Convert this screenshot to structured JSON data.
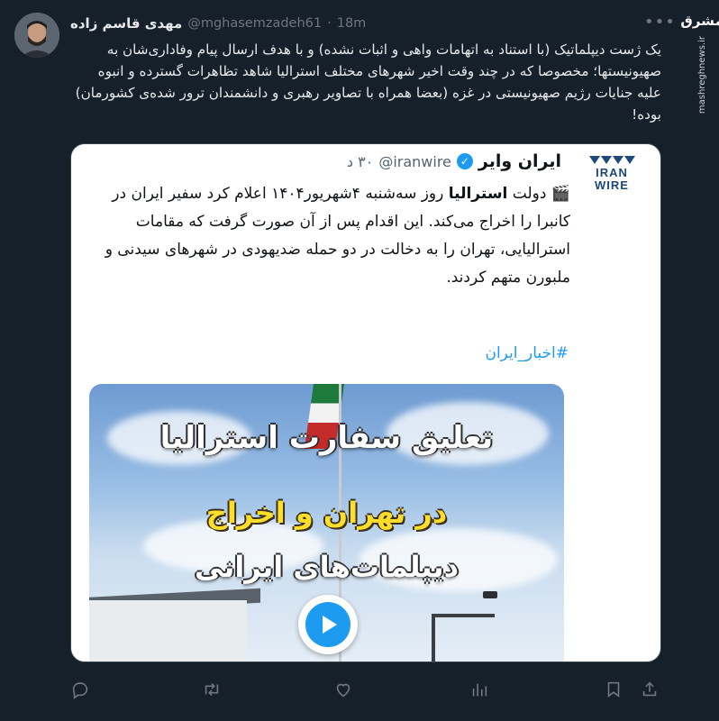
{
  "watermark": {
    "logo": "مشرق",
    "url": "mashreghnews.ir"
  },
  "tweet": {
    "author_name": "مهدی قاسم زاده",
    "handle": "@mghasemzadeh61",
    "separator": "·",
    "time": "18m",
    "text": "یک ژست دیپلماتیک (با استناد به اتهامات واهی و اثبات نشده) و با هدف ارسال پیام وفاداری‌شان به صهیونیستها؛ مخصوصا که در چند وقت اخیر شهرهای مختلف استرالیا شاهد تظاهرات گسترده و انبوه علیه جنایات رژیم صهیونیستی در غزه (بعضا همراه با تصاویر رهبری و دانشمندان ترور شده‌ی کشورمان) بوده!"
  },
  "quote": {
    "logo_text_1": "IRAN",
    "logo_text_2": "WIRE",
    "name": "ایران وایر",
    "handle": "@iranwire",
    "time": "۳۰ د",
    "text_prefix": "🎬 دولت ",
    "text_bold": "استرالیا",
    "text_rest": " روز سه‌شنبه ۴شهریور۱۴۰۴ اعلام کرد سفیر ایران در کانبرا را اخراج می‌کند. این اقدام پس از آن صورت گرفت که مقامات استرالیایی، تهران را به دخالت در دو حمله ضدیهودی در شهرهای سیدنی و ملبورن متهم کردند.",
    "hashtag": "#اخبار_ایران",
    "media": {
      "line1": "تعلیق سفارت استرالیا",
      "line2": "در تهران و اخراج",
      "line3": "دیپلمات‌های ایرانی"
    }
  },
  "colors": {
    "background": "#15202b",
    "accent": "#1d9bf0",
    "muted": "#71767b",
    "overlay_yellow": "#ffdd2b"
  }
}
